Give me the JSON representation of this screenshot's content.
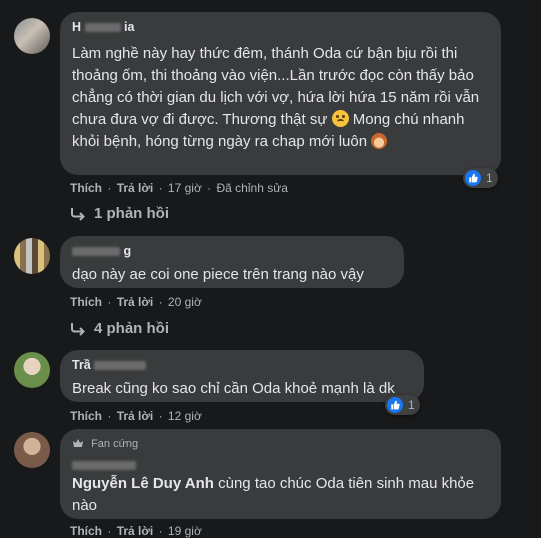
{
  "comments": [
    {
      "author": "H",
      "author_suffix": "ia",
      "text": "Làm nghề này hay thức đêm, thánh Oda cứ bận bịu rồi thi thoảng ốm, thi thoảng vào viện...Lần trước đọc còn thấy bảo chẳng có thời gian du lịch với vợ, hứa lời hứa 15 năm rồi vẫn chưa đưa vợ đi được. Thương thật sự",
      "text_line5": "Mong chú nhanh khỏi bệnh, hóng từng ngày ra chap mới luôn",
      "like_label": "Thích",
      "reply_label": "Trả lời",
      "time": "17 giờ",
      "edited": "Đã chỉnh sửa",
      "reaction_count": "1",
      "replies_label": "1 phản hồi"
    },
    {
      "author": "g",
      "text": "dạo này ae coi one piece trên trang nào vậy",
      "like_label": "Thích",
      "reply_label": "Trả lời",
      "time": "20 giờ",
      "replies_label": "4 phản hồi"
    },
    {
      "author": "Trầ",
      "text": "Break cũng ko sao chỉ cần Oda khoẻ mạnh là dk",
      "like_label": "Thích",
      "reply_label": "Trả lời",
      "time": "12 giờ",
      "reaction_count": "1"
    },
    {
      "badge": "Fan cứng",
      "mention": "Nguyễn Lê Duy Anh",
      "text": "cùng tao chúc Oda tiên sinh mau khỏe nào",
      "like_label": "Thích",
      "reply_label": "Trả lời",
      "time": "19 giờ"
    }
  ],
  "colors": {
    "background": "#18191a",
    "bubble": "#3a3b3c",
    "text": "#e4e6eb",
    "secondary": "#b0b3b8",
    "like_blue": "#1877f2"
  },
  "icons": [
    "like-icon",
    "reply-arrow-icon",
    "sad-emoji-icon",
    "girl-emoji-icon",
    "fan-badge-icon"
  ]
}
